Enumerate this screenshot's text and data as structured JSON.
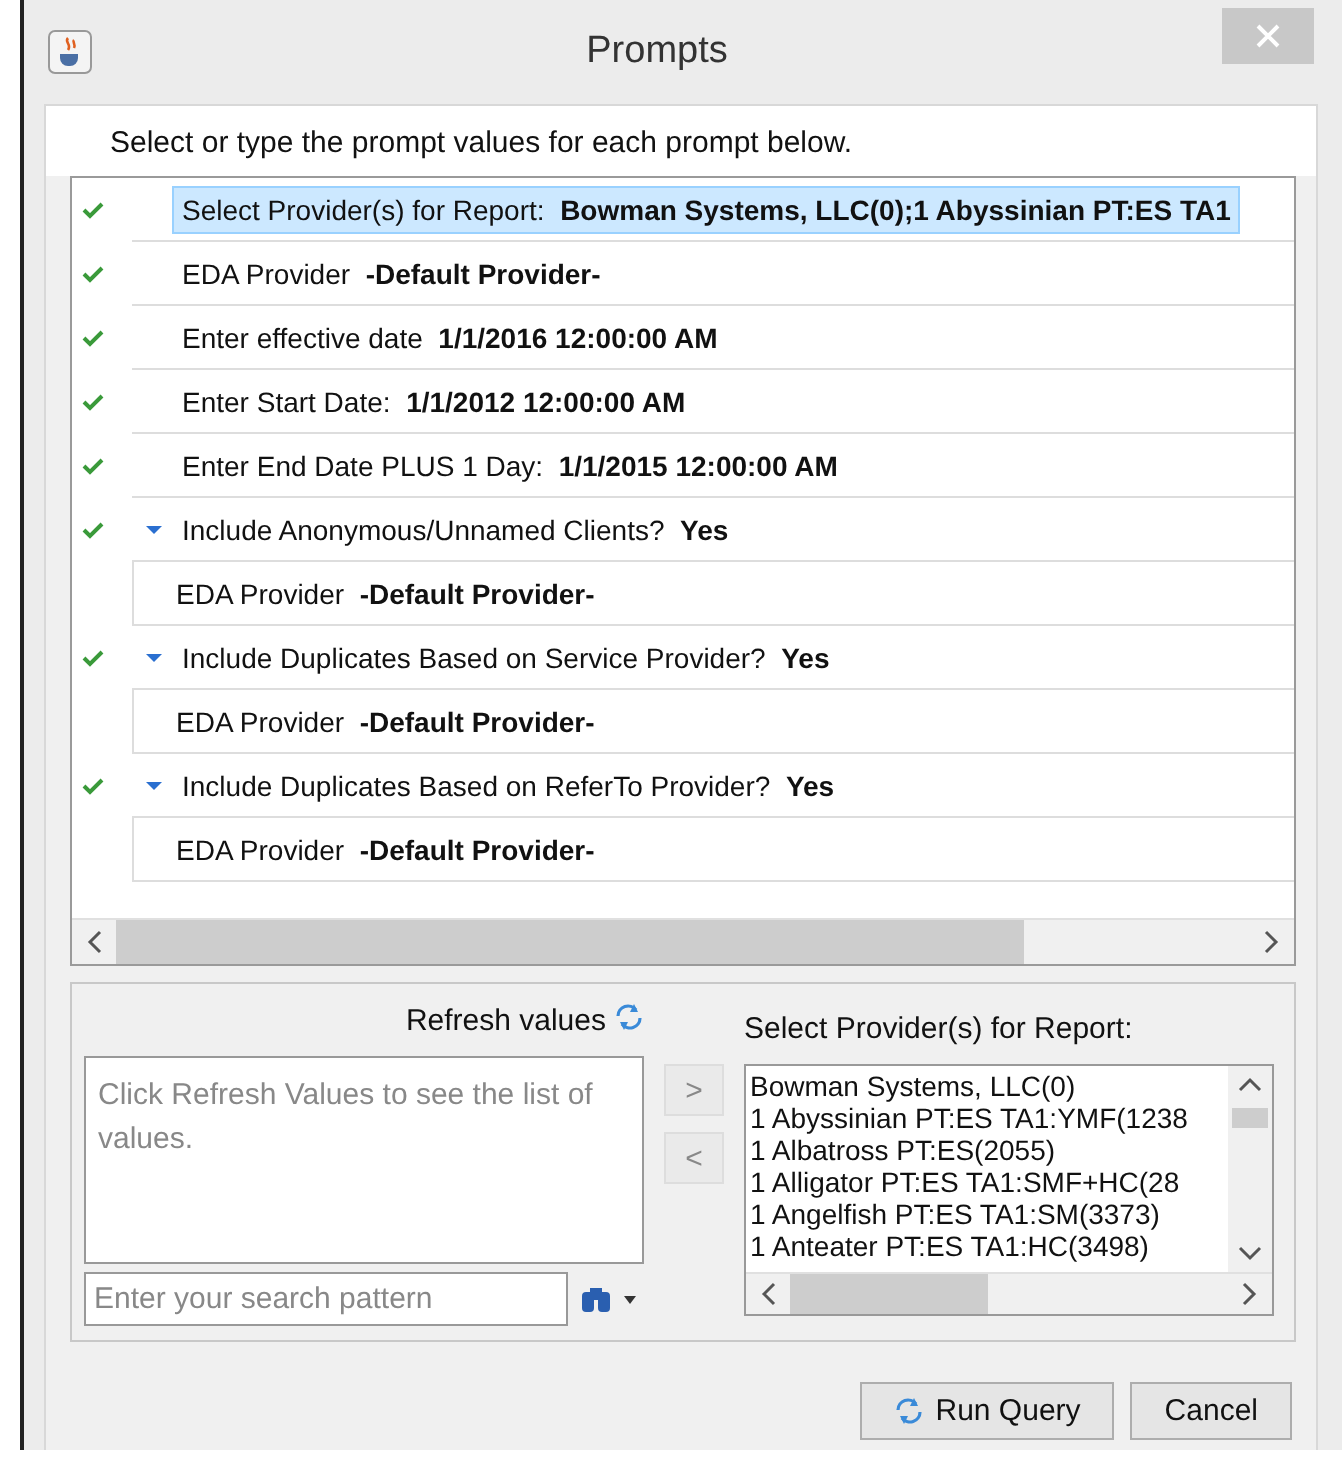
{
  "window": {
    "title": "Prompts"
  },
  "instruction": "Select or type the prompt values for each prompt below.",
  "prompts": [
    {
      "label": "Select Provider(s) for Report:",
      "value": "Bowman Systems, LLC(0);1 Abyssinian PT:ES TA1",
      "answered": true,
      "selected": true
    },
    {
      "label": "EDA Provider",
      "value": "-Default Provider-",
      "answered": true,
      "selected": false
    },
    {
      "label": "Enter effective date",
      "value": "1/1/2016 12:00:00 AM",
      "answered": true,
      "selected": false
    },
    {
      "label": "Enter Start Date:",
      "value": "1/1/2012 12:00:00 AM",
      "answered": true,
      "selected": false
    },
    {
      "label": "Enter End Date PLUS 1 Day:",
      "value": "1/1/2015 12:00:00 AM",
      "answered": true,
      "selected": false
    },
    {
      "label": "Include Anonymous/Unnamed Clients?",
      "value": "Yes",
      "answered": true,
      "selected": false,
      "expanded": true,
      "children": [
        {
          "label": "EDA Provider",
          "value": "-Default Provider-"
        }
      ]
    },
    {
      "label": "Include Duplicates Based on Service Provider?",
      "value": "Yes",
      "answered": true,
      "selected": false,
      "expanded": true,
      "children": [
        {
          "label": "EDA Provider",
          "value": "-Default Provider-"
        }
      ]
    },
    {
      "label": "Include Duplicates Based on ReferTo Provider?",
      "value": "Yes",
      "answered": true,
      "selected": false,
      "expanded": true,
      "children": [
        {
          "label": "EDA Provider",
          "value": "-Default Provider-"
        }
      ]
    }
  ],
  "refresh": {
    "label": "Refresh values"
  },
  "available_values": {
    "hint": "Click Refresh Values to see the list of values."
  },
  "search": {
    "placeholder": "Enter your search pattern"
  },
  "move_buttons": [
    {
      "label": ">"
    },
    {
      "label": "<"
    }
  ],
  "selected_list": {
    "title": "Select Provider(s) for Report:",
    "items": [
      "Bowman Systems, LLC(0)",
      "1 Abyssinian PT:ES TA1:YMF(1238",
      "1 Albatross PT:ES(2055)",
      "1 Alligator PT:ES TA1:SMF+HC(28",
      "1 Angelfish PT:ES TA1:SM(3373)",
      "1 Anteater PT:ES TA1:HC(3498)"
    ]
  },
  "buttons": [
    {
      "label": "Run Query",
      "kind": "run"
    },
    {
      "label": "Cancel",
      "kind": "cancel"
    }
  ]
}
